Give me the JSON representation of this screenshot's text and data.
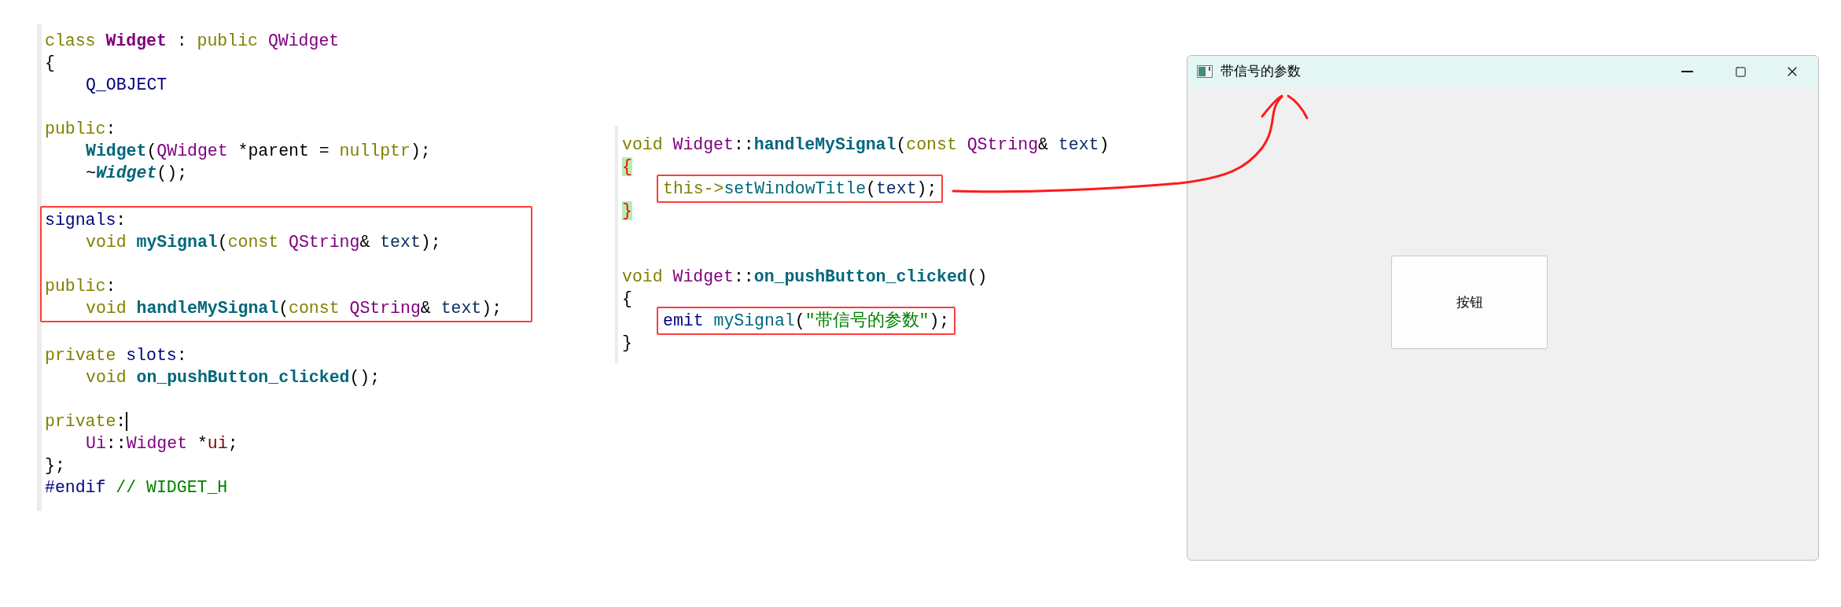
{
  "header_editor": {
    "blocks": [
      {
        "boxed": false,
        "lines": [
          {
            "kind": "code",
            "indented": false,
            "tokens": [
              {
                "text": "class ",
                "kind": "keyword"
              },
              {
                "text": "Widget",
                "kind": "class-name"
              },
              {
                "text": " : ",
                "kind": "plain"
              },
              {
                "text": "public ",
                "kind": "keyword"
              },
              {
                "text": "QWidget",
                "kind": "type"
              }
            ]
          },
          {
            "kind": "code",
            "indented": false,
            "tokens": [
              {
                "text": "{",
                "kind": "plain"
              }
            ]
          },
          {
            "kind": "code",
            "indented": true,
            "tokens": [
              {
                "text": "Q_OBJECT",
                "kind": "macro"
              }
            ]
          },
          {
            "kind": "blank"
          },
          {
            "kind": "code",
            "indented": false,
            "tokens": [
              {
                "text": "public",
                "kind": "keyword"
              },
              {
                "text": ":",
                "kind": "plain"
              }
            ]
          },
          {
            "kind": "code",
            "indented": true,
            "tokens": [
              {
                "text": "Widget",
                "kind": "function"
              },
              {
                "text": "(",
                "kind": "plain"
              },
              {
                "text": "QWidget",
                "kind": "type"
              },
              {
                "text": " *parent = ",
                "kind": "plain"
              },
              {
                "text": "nullptr",
                "kind": "keyword"
              },
              {
                "text": ");",
                "kind": "plain"
              }
            ]
          },
          {
            "kind": "code",
            "indented": true,
            "tokens": [
              {
                "text": "~",
                "kind": "plain"
              },
              {
                "text": "Widget",
                "kind": "function-italic"
              },
              {
                "text": "();",
                "kind": "plain"
              }
            ]
          },
          {
            "kind": "blank"
          }
        ]
      },
      {
        "boxed": true,
        "lines": [
          {
            "kind": "code",
            "indented": false,
            "tokens": [
              {
                "text": "signals",
                "kind": "macro"
              },
              {
                "text": ":",
                "kind": "plain"
              }
            ]
          },
          {
            "kind": "code",
            "indented": true,
            "tokens": [
              {
                "text": "void ",
                "kind": "keyword"
              },
              {
                "text": "mySignal",
                "kind": "function"
              },
              {
                "text": "(",
                "kind": "plain"
              },
              {
                "text": "const ",
                "kind": "keyword"
              },
              {
                "text": "QString",
                "kind": "type"
              },
              {
                "text": "& ",
                "kind": "plain"
              },
              {
                "text": "text",
                "kind": "param"
              },
              {
                "text": ");",
                "kind": "plain"
              }
            ]
          },
          {
            "kind": "blank"
          },
          {
            "kind": "code",
            "indented": false,
            "tokens": [
              {
                "text": "public",
                "kind": "keyword"
              },
              {
                "text": ":",
                "kind": "plain"
              }
            ]
          },
          {
            "kind": "code",
            "indented": true,
            "tokens": [
              {
                "text": "void ",
                "kind": "keyword"
              },
              {
                "text": "handleMySignal",
                "kind": "function"
              },
              {
                "text": "(",
                "kind": "plain"
              },
              {
                "text": "const ",
                "kind": "keyword"
              },
              {
                "text": "QString",
                "kind": "type"
              },
              {
                "text": "& ",
                "kind": "plain"
              },
              {
                "text": "text",
                "kind": "param"
              },
              {
                "text": ");",
                "kind": "plain"
              }
            ]
          }
        ]
      },
      {
        "boxed": false,
        "lines": [
          {
            "kind": "blank"
          },
          {
            "kind": "code",
            "indented": false,
            "tokens": [
              {
                "text": "private ",
                "kind": "keyword"
              },
              {
                "text": "slots",
                "kind": "macro"
              },
              {
                "text": ":",
                "kind": "plain"
              }
            ]
          },
          {
            "kind": "code",
            "indented": true,
            "tokens": [
              {
                "text": "void ",
                "kind": "keyword"
              },
              {
                "text": "on_pushButton_clicked",
                "kind": "function"
              },
              {
                "text": "();",
                "kind": "plain"
              }
            ]
          },
          {
            "kind": "blank"
          },
          {
            "kind": "code",
            "indented": false,
            "cursor": true,
            "tokens": [
              {
                "text": "private",
                "kind": "keyword"
              },
              {
                "text": ":",
                "kind": "plain"
              }
            ]
          },
          {
            "kind": "code",
            "indented": true,
            "tokens": [
              {
                "text": "Ui",
                "kind": "type"
              },
              {
                "text": "::",
                "kind": "plain"
              },
              {
                "text": "Widget",
                "kind": "type"
              },
              {
                "text": " *",
                "kind": "plain"
              },
              {
                "text": "ui",
                "kind": "member"
              },
              {
                "text": ";",
                "kind": "plain"
              }
            ]
          },
          {
            "kind": "code",
            "indented": false,
            "tokens": [
              {
                "text": "};",
                "kind": "plain"
              }
            ]
          },
          {
            "kind": "code",
            "indented": false,
            "tokens": [
              {
                "text": "#endif ",
                "kind": "macro"
              },
              {
                "text": "// WIDGET_H",
                "kind": "comment"
              }
            ]
          }
        ]
      }
    ]
  },
  "source_editor": {
    "lines": [
      {
        "kind": "code",
        "indented": false,
        "boxed": false,
        "tokens": [
          {
            "text": "void ",
            "kind": "keyword"
          },
          {
            "text": "Widget",
            "kind": "type"
          },
          {
            "text": "::",
            "kind": "plain"
          },
          {
            "text": "handleMySignal",
            "kind": "function"
          },
          {
            "text": "(",
            "kind": "plain"
          },
          {
            "text": "const ",
            "kind": "keyword"
          },
          {
            "text": "QString",
            "kind": "type"
          },
          {
            "text": "& ",
            "kind": "plain"
          },
          {
            "text": "text",
            "kind": "param"
          },
          {
            "text": ")",
            "kind": "plain"
          }
        ]
      },
      {
        "kind": "code",
        "indented": false,
        "boxed": false,
        "tokens": [
          {
            "text": "{",
            "kind": "brace-match"
          }
        ]
      },
      {
        "kind": "code",
        "indented": true,
        "boxed": true,
        "tokens": [
          {
            "text": "this->",
            "kind": "keyword"
          },
          {
            "text": "setWindowTitle",
            "kind": "call"
          },
          {
            "text": "(",
            "kind": "plain"
          },
          {
            "text": "text",
            "kind": "param"
          },
          {
            "text": ");",
            "kind": "plain"
          }
        ]
      },
      {
        "kind": "code",
        "indented": false,
        "boxed": false,
        "tokens": [
          {
            "text": "}",
            "kind": "brace-match"
          }
        ]
      },
      {
        "kind": "blank"
      },
      {
        "kind": "blank"
      },
      {
        "kind": "code",
        "indented": false,
        "boxed": false,
        "tokens": [
          {
            "text": "void ",
            "kind": "keyword"
          },
          {
            "text": "Widget",
            "kind": "type"
          },
          {
            "text": "::",
            "kind": "plain"
          },
          {
            "text": "on_pushButton_clicked",
            "kind": "function"
          },
          {
            "text": "()",
            "kind": "plain"
          }
        ]
      },
      {
        "kind": "code",
        "indented": false,
        "boxed": false,
        "tokens": [
          {
            "text": "{",
            "kind": "plain"
          }
        ]
      },
      {
        "kind": "code",
        "indented": true,
        "boxed": true,
        "tokens": [
          {
            "text": "emit ",
            "kind": "macro"
          },
          {
            "text": "mySignal",
            "kind": "call"
          },
          {
            "text": "(",
            "kind": "plain"
          },
          {
            "text": "\"带信号的参数\"",
            "kind": "string"
          },
          {
            "text": ");",
            "kind": "plain"
          }
        ]
      },
      {
        "kind": "code",
        "indented": false,
        "boxed": false,
        "tokens": [
          {
            "text": "}",
            "kind": "plain"
          }
        ]
      }
    ]
  },
  "window": {
    "title": "带信号的参数",
    "button": "按钮"
  }
}
